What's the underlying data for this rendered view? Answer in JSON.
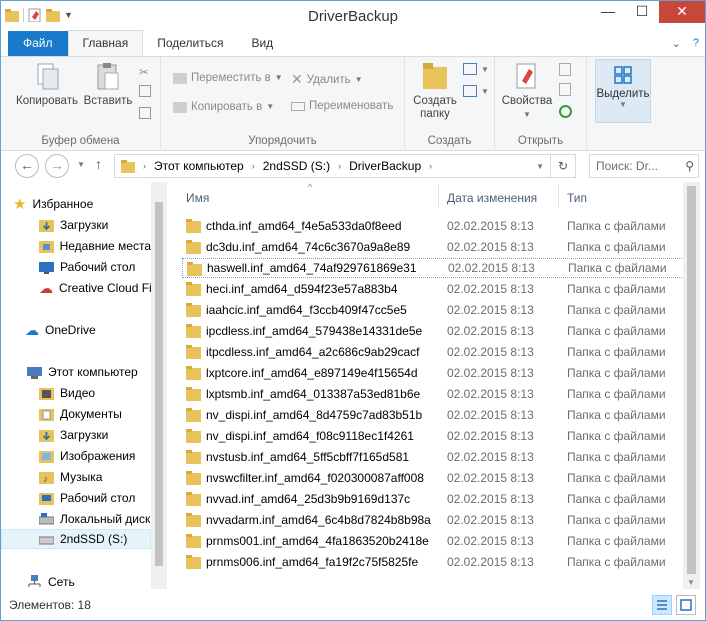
{
  "window": {
    "title": "DriverBackup"
  },
  "tabs": [
    {
      "label": "Файл"
    },
    {
      "label": "Главная"
    },
    {
      "label": "Поделиться"
    },
    {
      "label": "Вид"
    }
  ],
  "ribbon": {
    "clipboard": {
      "copy": "Копировать",
      "paste": "Вставить",
      "group": "Буфер обмена"
    },
    "organize": {
      "move": "Переместить в",
      "copy_to": "Копировать в",
      "delete": "Удалить",
      "rename": "Переименовать",
      "group": "Упорядочить"
    },
    "new": {
      "new_folder": "Создать папку",
      "group": "Создать"
    },
    "open": {
      "properties": "Свойства",
      "group": "Открыть"
    },
    "select": {
      "select": "Выделить"
    }
  },
  "address": {
    "crumbs": [
      "Этот компьютер",
      "2ndSSD (S:)",
      "DriverBackup"
    ],
    "search_placeholder": "Поиск: Dr..."
  },
  "nav": {
    "favorites": "Избранное",
    "downloads": "Загрузки",
    "recent": "Недавние места",
    "desktop": "Рабочий стол",
    "creative": "Creative Cloud Fi",
    "onedrive": "OneDrive",
    "this_pc": "Этот компьютер",
    "video": "Видео",
    "documents": "Документы",
    "downloads2": "Загрузки",
    "images": "Изображения",
    "music": "Музыка",
    "desktop2": "Рабочий стол",
    "local_disk": "Локальный диск",
    "ssd": "2ndSSD (S:)",
    "network": "Сеть"
  },
  "columns": {
    "name": "Имя",
    "date": "Дата изменения",
    "type": "Тип"
  },
  "files": [
    {
      "name": "cthda.inf_amd64_f4e5a533da0f8eed",
      "date": "02.02.2015 8:13",
      "type": "Папка с файлами"
    },
    {
      "name": "dc3du.inf_amd64_74c6c3670a9a8e89",
      "date": "02.02.2015 8:13",
      "type": "Папка с файлами"
    },
    {
      "name": "haswell.inf_amd64_74af929761869e31",
      "date": "02.02.2015 8:13",
      "type": "Папка с файлами"
    },
    {
      "name": "heci.inf_amd64_d594f23e57a883b4",
      "date": "02.02.2015 8:13",
      "type": "Папка с файлами"
    },
    {
      "name": "iaahcic.inf_amd64_f3ccb409f47cc5e5",
      "date": "02.02.2015 8:13",
      "type": "Папка с файлами"
    },
    {
      "name": "ipcdless.inf_amd64_579438e14331de5e",
      "date": "02.02.2015 8:13",
      "type": "Папка с файлами"
    },
    {
      "name": "itpcdless.inf_amd64_a2c686c9ab29cacf",
      "date": "02.02.2015 8:13",
      "type": "Папка с файлами"
    },
    {
      "name": "lxptcore.inf_amd64_e897149e4f15654d",
      "date": "02.02.2015 8:13",
      "type": "Папка с файлами"
    },
    {
      "name": "lxptsmb.inf_amd64_013387a53ed81b6e",
      "date": "02.02.2015 8:13",
      "type": "Папка с файлами"
    },
    {
      "name": "nv_dispi.inf_amd64_8d4759c7ad83b51b",
      "date": "02.02.2015 8:13",
      "type": "Папка с файлами"
    },
    {
      "name": "nv_dispi.inf_amd64_f08c9118ec1f4261",
      "date": "02.02.2015 8:13",
      "type": "Папка с файлами"
    },
    {
      "name": "nvstusb.inf_amd64_5ff5cbff7f165d581",
      "date": "02.02.2015 8:13",
      "type": "Папка с файлами"
    },
    {
      "name": "nvswcfilter.inf_amd64_f020300087aff008",
      "date": "02.02.2015 8:13",
      "type": "Папка с файлами"
    },
    {
      "name": "nvvad.inf_amd64_25d3b9b9169d137c",
      "date": "02.02.2015 8:13",
      "type": "Папка с файлами"
    },
    {
      "name": "nvvadarm.inf_amd64_6c4b8d7824b8b98a",
      "date": "02.02.2015 8:13",
      "type": "Папка с файлами"
    },
    {
      "name": "prnms001.inf_amd64_4fa1863520b2418e",
      "date": "02.02.2015 8:13",
      "type": "Папка с файлами"
    },
    {
      "name": "prnms006.inf_amd64_fa19f2c75f5825fe",
      "date": "02.02.2015 8:13",
      "type": "Папка с файлами"
    }
  ],
  "status": {
    "count": "Элементов: 18"
  },
  "colors": {
    "accent": "#1979ca",
    "folder": "#e8c25a",
    "selection": "#e5f3fb",
    "close": "#c7473a"
  }
}
